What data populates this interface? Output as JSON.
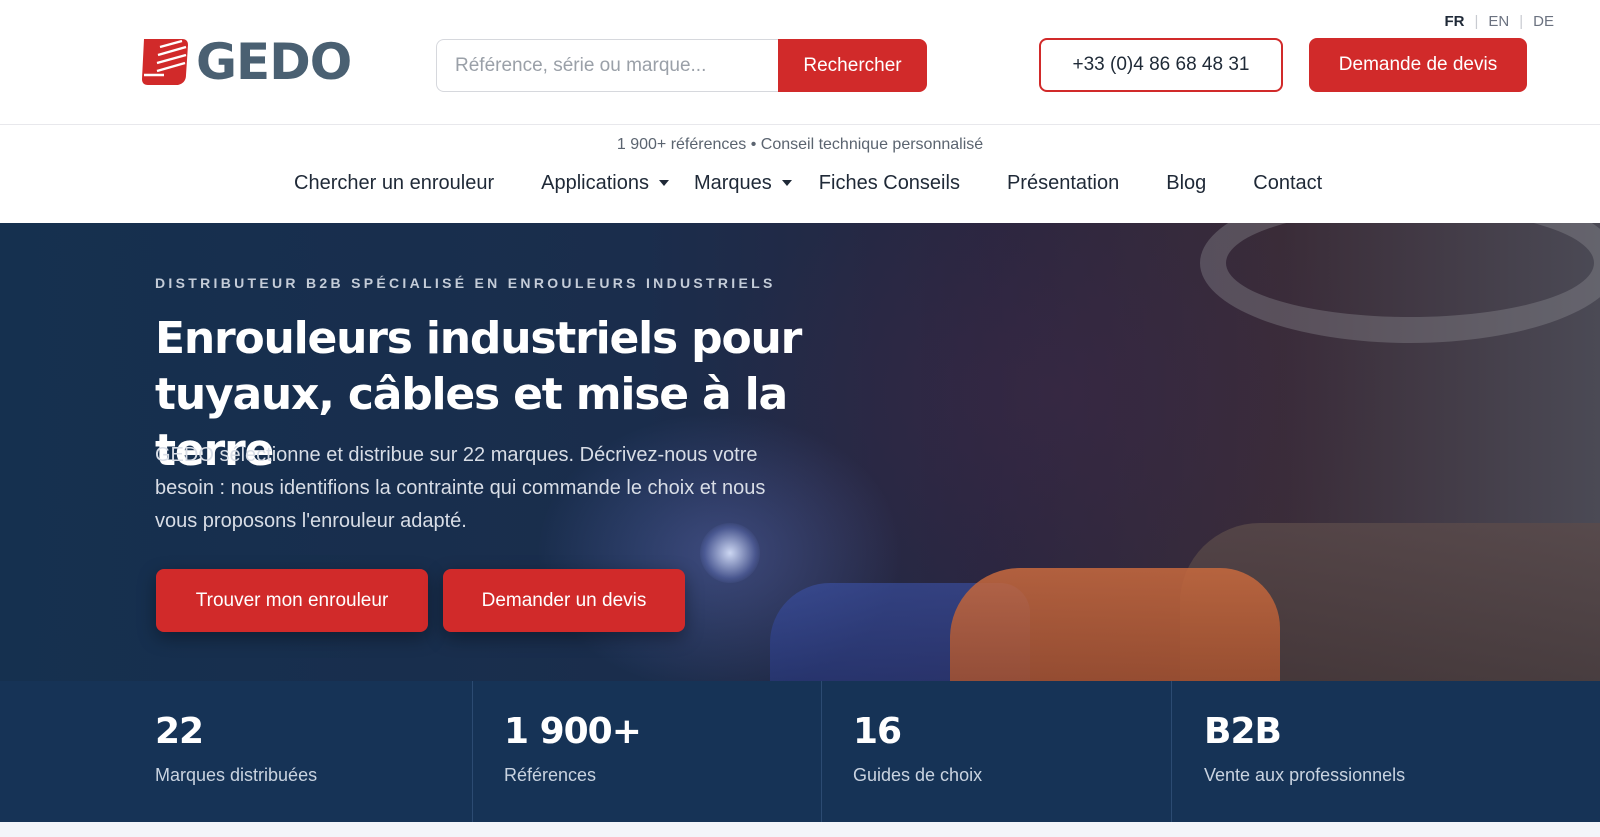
{
  "header": {
    "logo_text": "GEDO",
    "search": {
      "placeholder": "Référence, série ou marque...",
      "value": "",
      "button_label": "Rechercher"
    },
    "phone_label": "+33 (0)4 86 68 48 31",
    "quote_label": "Demande de devis",
    "languages": [
      "FR",
      "EN",
      "DE"
    ],
    "active_language": "FR"
  },
  "nav": {
    "tagline": "1 900+ références • Conseil technique personnalisé",
    "items": [
      {
        "label": "Chercher un enrouleur"
      },
      {
        "label": "Applications",
        "dropdown": true
      },
      {
        "label": "Marques",
        "dropdown": true
      },
      {
        "label": "Fiches Conseils"
      },
      {
        "label": "Présentation"
      },
      {
        "label": "Blog"
      },
      {
        "label": "Contact"
      }
    ]
  },
  "hero": {
    "kicker": "DISTRIBUTEUR B2B SPÉCIALISÉ EN ENROULEURS INDUSTRIELS",
    "title_line1": "Enrouleurs industriels pour",
    "title_line2": "tuyaux, câbles et mise à la terre",
    "description": "GEDO sélectionne et distribue sur 22 marques. Décrivez-nous votre besoin : nous identifions la contrainte qui commande le choix et nous vous proposons l'enrouleur adapté.",
    "cta_primary": "Trouver mon enrouleur",
    "cta_secondary": "Demander un devis"
  },
  "stats": [
    {
      "value": "22",
      "label": "Marques distribuées"
    },
    {
      "value": "1 900+",
      "label": "Références"
    },
    {
      "value": "16",
      "label": "Guides de choix"
    },
    {
      "value": "B2B",
      "label": "Vente aux professionnels"
    }
  ],
  "colors": {
    "accent": "#d12a2a",
    "logo_text": "#4a6072",
    "hero_bg": "#15304f",
    "stats_bg": "#163356"
  }
}
